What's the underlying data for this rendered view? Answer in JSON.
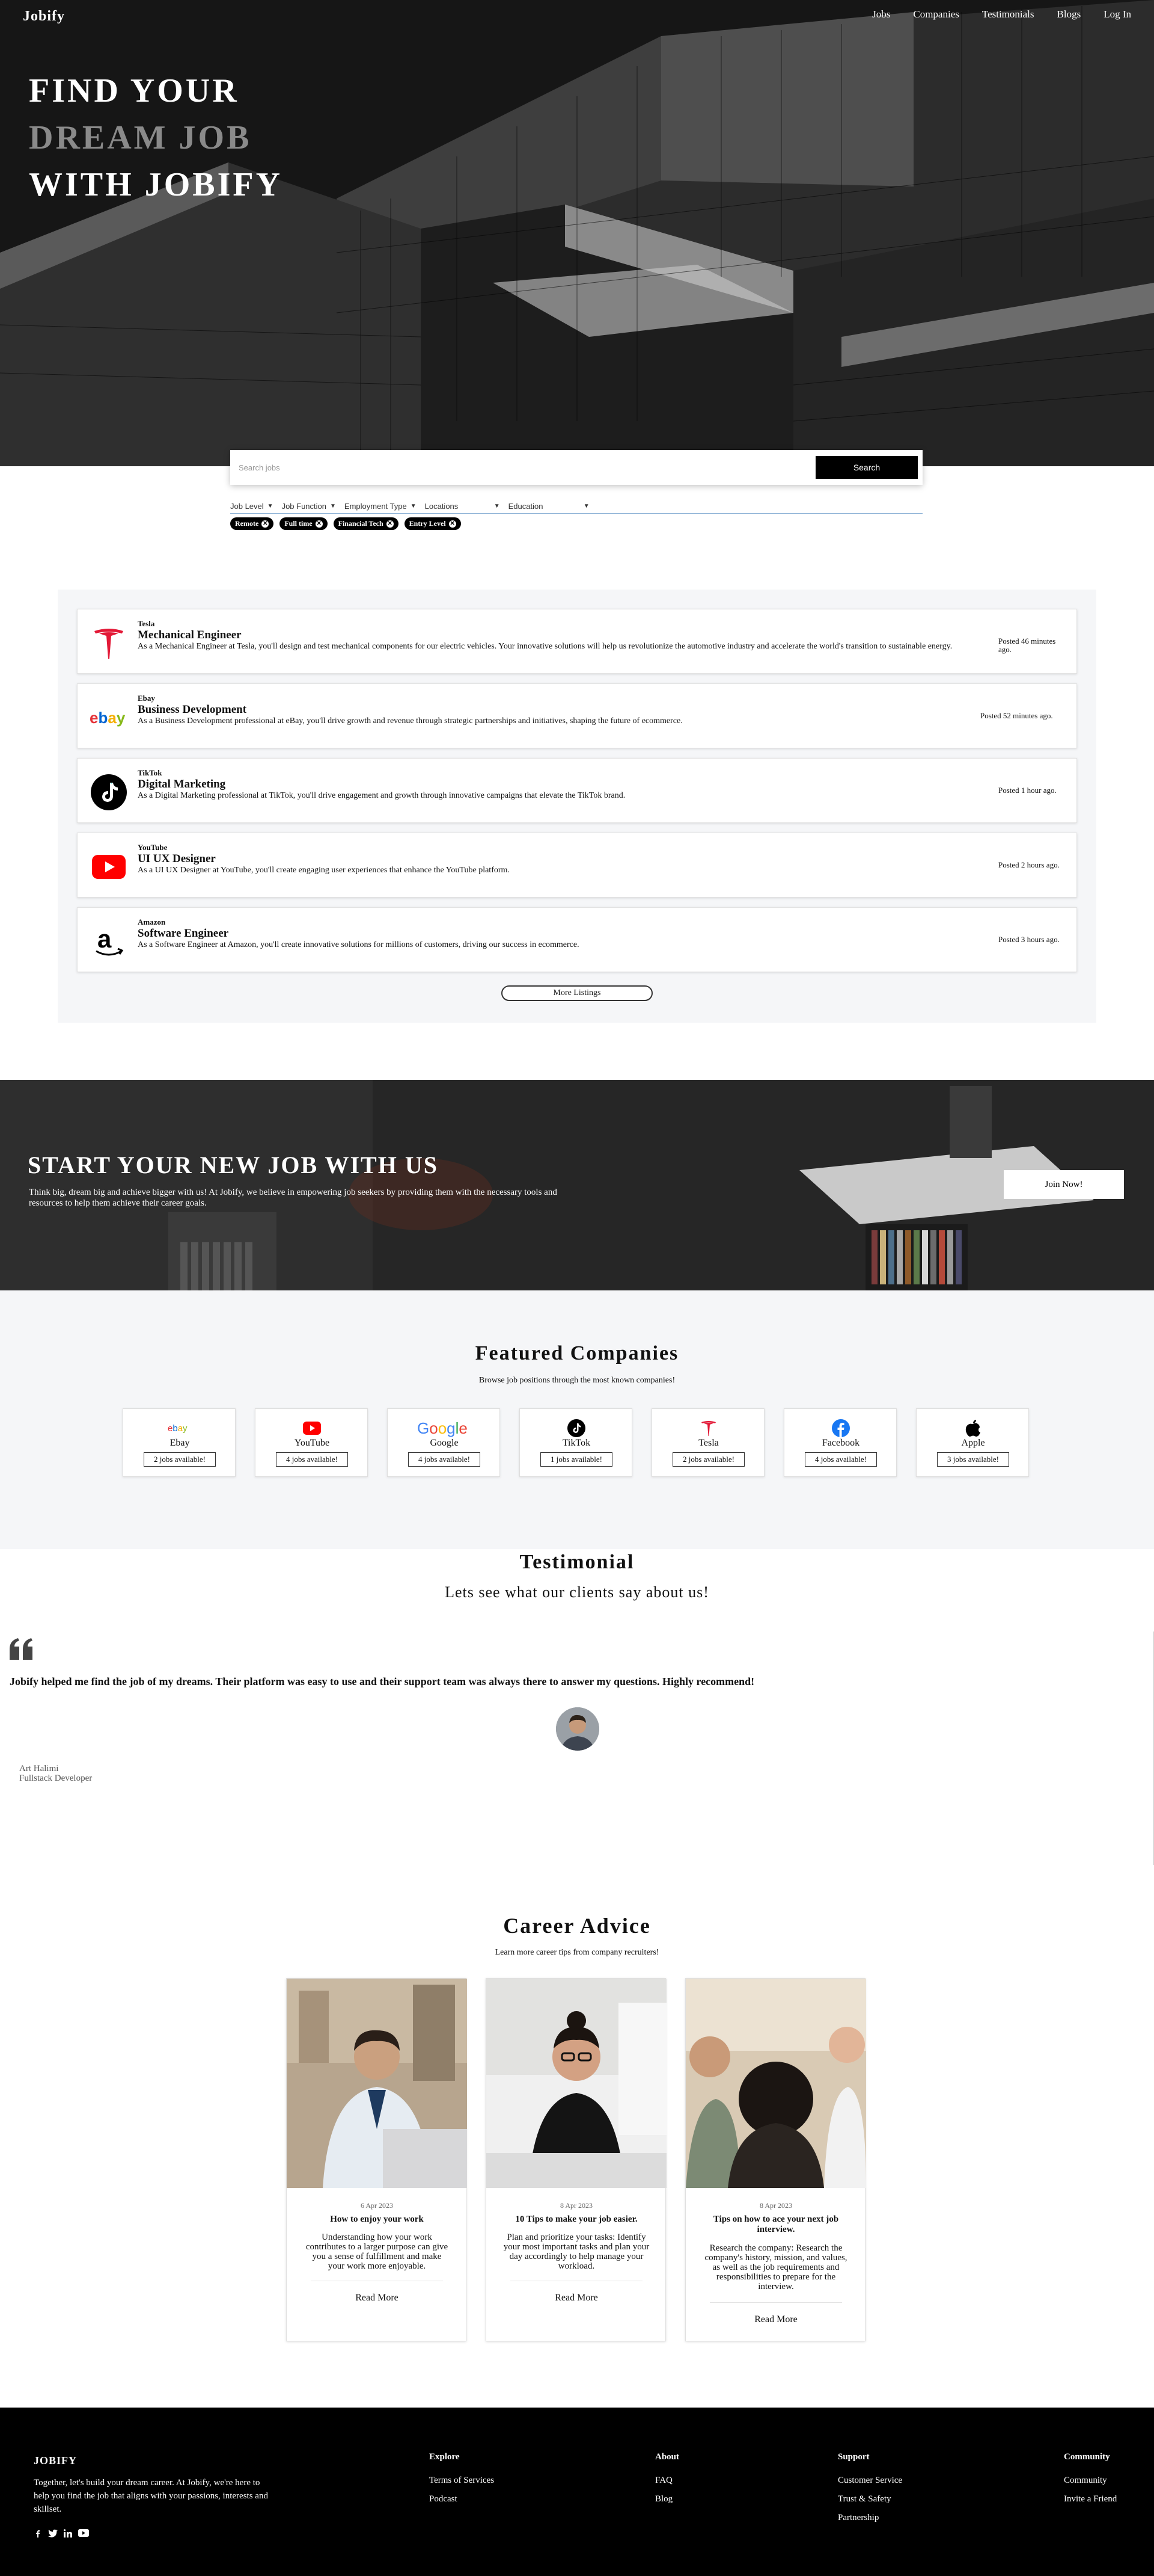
{
  "nav": {
    "brand": "Jobify",
    "links": [
      "Jobs",
      "Companies",
      "Testimonials",
      "Blogs",
      "Log In"
    ]
  },
  "hero": {
    "line1": "FIND YOUR",
    "line2": "DREAM JOB",
    "line3": "WITH JOBIFY"
  },
  "search": {
    "placeholder": "Search jobs",
    "button": "Search",
    "filters": [
      "Job Level",
      "Job Function",
      "Employment Type",
      "Locations",
      "Education"
    ],
    "chips": [
      "Remote",
      "Full time",
      "Financial Tech",
      "Entry Level"
    ]
  },
  "listings": {
    "jobs": [
      {
        "company": "Tesla",
        "role": "Mechanical Engineer",
        "desc": "As a Mechanical Engineer at Tesla, you'll design and test mechanical components for our electric vehicles. Your innovative solutions will help us revolutionize the automotive industry and accelerate the world's transition to sustainable energy.",
        "posted": "Posted 46 minutes ago."
      },
      {
        "company": "Ebay",
        "role": "Business Development",
        "desc": "As a Business Development professional at eBay, you'll drive growth and revenue through strategic partnerships and initiatives, shaping the future of ecommerce.",
        "posted": "Posted 52 minutes ago."
      },
      {
        "company": "TikTok",
        "role": "Digital Marketing",
        "desc": "As a Digital Marketing professional at TikTok, you'll drive engagement and growth through innovative campaigns that elevate the TikTok brand.",
        "posted": "Posted 1 hour ago."
      },
      {
        "company": "YouTube",
        "role": "UI UX Designer",
        "desc": "As a UI UX Designer at YouTube, you'll create engaging user experiences that enhance the YouTube platform.",
        "posted": "Posted 2 hours ago."
      },
      {
        "company": "Amazon",
        "role": "Software Engineer",
        "desc": "As a Software Engineer at Amazon, you'll create innovative solutions for millions of customers, driving our success in ecommerce.",
        "posted": "Posted 3 hours ago."
      }
    ],
    "more": "More Listings"
  },
  "cta": {
    "title": "START YOUR NEW JOB WITH US",
    "text": "Think big, dream big and achieve bigger with us! At Jobify, we believe in empowering job seekers by providing them with the necessary tools and resources to help them achieve their career goals.",
    "button": "Join Now!"
  },
  "featured": {
    "title": "Featured Companies",
    "subtitle": "Browse job positions through the most known companies!",
    "companies": [
      {
        "name": "Ebay",
        "jobs": "2 jobs available!"
      },
      {
        "name": "YouTube",
        "jobs": "4 jobs available!"
      },
      {
        "name": "Google",
        "jobs": "4 jobs available!"
      },
      {
        "name": "TikTok",
        "jobs": "1 jobs available!"
      },
      {
        "name": "Tesla",
        "jobs": "2 jobs available!"
      },
      {
        "name": "Facebook",
        "jobs": "4 jobs available!"
      },
      {
        "name": "Apple",
        "jobs": "3 jobs available!"
      }
    ]
  },
  "testimonial": {
    "title": "Testimonial",
    "subtitle": "Lets see what our clients say about us!",
    "quote": "Jobify helped me find the job of my dreams. Their platform was easy to use and their support team was always there to answer my questions. Highly recommend!",
    "author": "Art Halimi",
    "position": "Fullstack Developer"
  },
  "advice": {
    "title": "Career Advice",
    "subtitle": "Learn more career tips from company recruiters!",
    "posts": [
      {
        "date": "6 Apr 2023",
        "title": "How to enjoy your work",
        "desc": "Understanding how your work contributes to a larger purpose can give you a sense of fulfillment and make your work more enjoyable.",
        "more": "Read More"
      },
      {
        "date": "8 Apr 2023",
        "title": "10 Tips to make your job easier.",
        "desc": "Plan and prioritize your tasks: Identify your most important tasks and plan your day accordingly to help manage your workload.",
        "more": "Read More"
      },
      {
        "date": "8 Apr 2023",
        "title": "Tips on how to ace your next job interview.",
        "desc": "Research the company: Research the company's history, mission, and values, as well as the job requirements and responsibilities to prepare for the interview.",
        "more": "Read More"
      }
    ]
  },
  "footer": {
    "brand": "JOBIFY",
    "desc": "Together, let's build your dream career. At Jobify, we're here to help you find the job that aligns with your passions, interests and skillset.",
    "columns": [
      {
        "title": "Explore",
        "links": [
          "Terms of Services",
          "Podcast"
        ]
      },
      {
        "title": "About",
        "links": [
          "FAQ",
          "Blog"
        ]
      },
      {
        "title": "Support",
        "links": [
          "Customer Service",
          "Trust & Safety",
          "Partnership"
        ]
      },
      {
        "title": "Community",
        "links": [
          "Community",
          "Invite a Friend"
        ]
      }
    ],
    "social": [
      "facebook-icon",
      "twitter-icon",
      "linkedin-icon",
      "youtube-icon"
    ]
  },
  "colors": {
    "primary": "#000000",
    "section_bg": "#f5f6f8",
    "link_line": "#8fb3d6"
  }
}
